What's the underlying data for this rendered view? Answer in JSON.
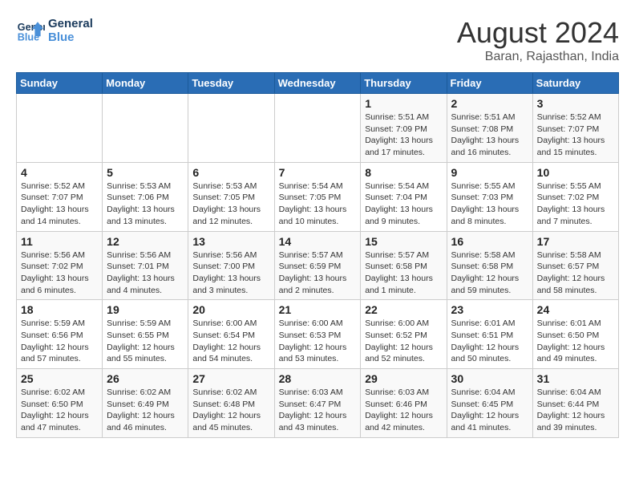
{
  "logo": {
    "line1": "General",
    "line2": "Blue"
  },
  "title": "August 2024",
  "location": "Baran, Rajasthan, India",
  "days_of_week": [
    "Sunday",
    "Monday",
    "Tuesday",
    "Wednesday",
    "Thursday",
    "Friday",
    "Saturday"
  ],
  "weeks": [
    [
      {
        "day": "",
        "detail": ""
      },
      {
        "day": "",
        "detail": ""
      },
      {
        "day": "",
        "detail": ""
      },
      {
        "day": "",
        "detail": ""
      },
      {
        "day": "1",
        "detail": "Sunrise: 5:51 AM\nSunset: 7:09 PM\nDaylight: 13 hours\nand 17 minutes."
      },
      {
        "day": "2",
        "detail": "Sunrise: 5:51 AM\nSunset: 7:08 PM\nDaylight: 13 hours\nand 16 minutes."
      },
      {
        "day": "3",
        "detail": "Sunrise: 5:52 AM\nSunset: 7:07 PM\nDaylight: 13 hours\nand 15 minutes."
      }
    ],
    [
      {
        "day": "4",
        "detail": "Sunrise: 5:52 AM\nSunset: 7:07 PM\nDaylight: 13 hours\nand 14 minutes."
      },
      {
        "day": "5",
        "detail": "Sunrise: 5:53 AM\nSunset: 7:06 PM\nDaylight: 13 hours\nand 13 minutes."
      },
      {
        "day": "6",
        "detail": "Sunrise: 5:53 AM\nSunset: 7:05 PM\nDaylight: 13 hours\nand 12 minutes."
      },
      {
        "day": "7",
        "detail": "Sunrise: 5:54 AM\nSunset: 7:05 PM\nDaylight: 13 hours\nand 10 minutes."
      },
      {
        "day": "8",
        "detail": "Sunrise: 5:54 AM\nSunset: 7:04 PM\nDaylight: 13 hours\nand 9 minutes."
      },
      {
        "day": "9",
        "detail": "Sunrise: 5:55 AM\nSunset: 7:03 PM\nDaylight: 13 hours\nand 8 minutes."
      },
      {
        "day": "10",
        "detail": "Sunrise: 5:55 AM\nSunset: 7:02 PM\nDaylight: 13 hours\nand 7 minutes."
      }
    ],
    [
      {
        "day": "11",
        "detail": "Sunrise: 5:56 AM\nSunset: 7:02 PM\nDaylight: 13 hours\nand 6 minutes."
      },
      {
        "day": "12",
        "detail": "Sunrise: 5:56 AM\nSunset: 7:01 PM\nDaylight: 13 hours\nand 4 minutes."
      },
      {
        "day": "13",
        "detail": "Sunrise: 5:56 AM\nSunset: 7:00 PM\nDaylight: 13 hours\nand 3 minutes."
      },
      {
        "day": "14",
        "detail": "Sunrise: 5:57 AM\nSunset: 6:59 PM\nDaylight: 13 hours\nand 2 minutes."
      },
      {
        "day": "15",
        "detail": "Sunrise: 5:57 AM\nSunset: 6:58 PM\nDaylight: 13 hours\nand 1 minute."
      },
      {
        "day": "16",
        "detail": "Sunrise: 5:58 AM\nSunset: 6:58 PM\nDaylight: 12 hours\nand 59 minutes."
      },
      {
        "day": "17",
        "detail": "Sunrise: 5:58 AM\nSunset: 6:57 PM\nDaylight: 12 hours\nand 58 minutes."
      }
    ],
    [
      {
        "day": "18",
        "detail": "Sunrise: 5:59 AM\nSunset: 6:56 PM\nDaylight: 12 hours\nand 57 minutes."
      },
      {
        "day": "19",
        "detail": "Sunrise: 5:59 AM\nSunset: 6:55 PM\nDaylight: 12 hours\nand 55 minutes."
      },
      {
        "day": "20",
        "detail": "Sunrise: 6:00 AM\nSunset: 6:54 PM\nDaylight: 12 hours\nand 54 minutes."
      },
      {
        "day": "21",
        "detail": "Sunrise: 6:00 AM\nSunset: 6:53 PM\nDaylight: 12 hours\nand 53 minutes."
      },
      {
        "day": "22",
        "detail": "Sunrise: 6:00 AM\nSunset: 6:52 PM\nDaylight: 12 hours\nand 52 minutes."
      },
      {
        "day": "23",
        "detail": "Sunrise: 6:01 AM\nSunset: 6:51 PM\nDaylight: 12 hours\nand 50 minutes."
      },
      {
        "day": "24",
        "detail": "Sunrise: 6:01 AM\nSunset: 6:50 PM\nDaylight: 12 hours\nand 49 minutes."
      }
    ],
    [
      {
        "day": "25",
        "detail": "Sunrise: 6:02 AM\nSunset: 6:50 PM\nDaylight: 12 hours\nand 47 minutes."
      },
      {
        "day": "26",
        "detail": "Sunrise: 6:02 AM\nSunset: 6:49 PM\nDaylight: 12 hours\nand 46 minutes."
      },
      {
        "day": "27",
        "detail": "Sunrise: 6:02 AM\nSunset: 6:48 PM\nDaylight: 12 hours\nand 45 minutes."
      },
      {
        "day": "28",
        "detail": "Sunrise: 6:03 AM\nSunset: 6:47 PM\nDaylight: 12 hours\nand 43 minutes."
      },
      {
        "day": "29",
        "detail": "Sunrise: 6:03 AM\nSunset: 6:46 PM\nDaylight: 12 hours\nand 42 minutes."
      },
      {
        "day": "30",
        "detail": "Sunrise: 6:04 AM\nSunset: 6:45 PM\nDaylight: 12 hours\nand 41 minutes."
      },
      {
        "day": "31",
        "detail": "Sunrise: 6:04 AM\nSunset: 6:44 PM\nDaylight: 12 hours\nand 39 minutes."
      }
    ]
  ]
}
